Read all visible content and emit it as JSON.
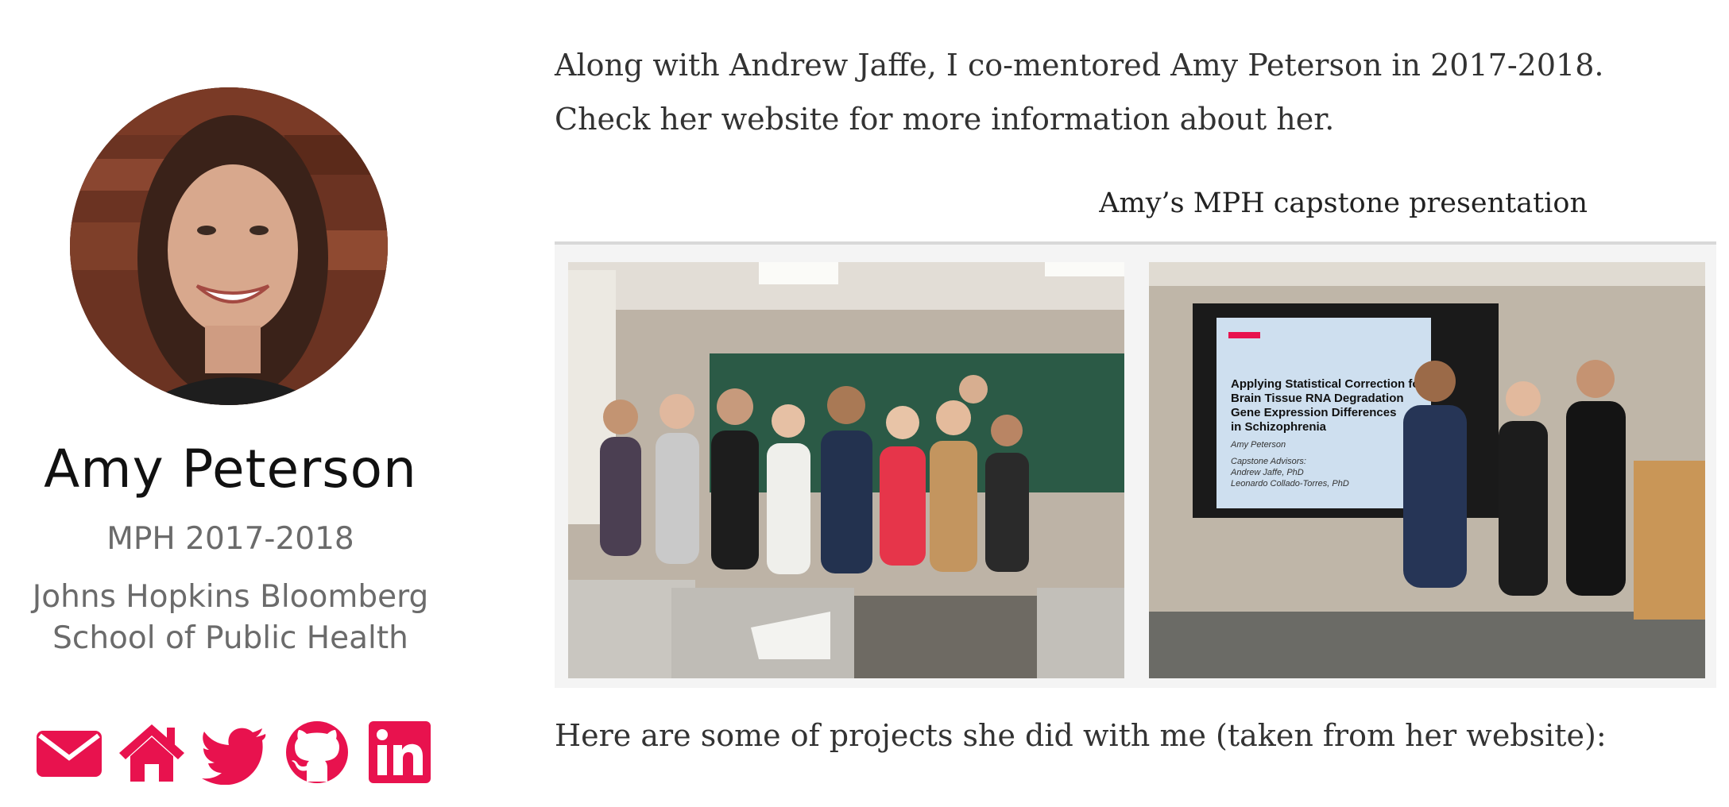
{
  "profile": {
    "name": "Amy Peterson",
    "role": "MPH 2017-2018",
    "org_line1": "Johns Hopkins Bloomberg",
    "org_line2": "School of Public Health"
  },
  "social": [
    {
      "icon": "envelope-icon"
    },
    {
      "icon": "home-icon"
    },
    {
      "icon": "twitter-icon"
    },
    {
      "icon": "github-icon"
    },
    {
      "icon": "linkedin-icon"
    }
  ],
  "colors": {
    "accent": "#e8124e",
    "text": "#333333",
    "muted": "#6b6b6b"
  },
  "content": {
    "intro": "Along with Andrew Jaffe, I co-mentored Amy Peterson in 2017-2018. Check her website for more information about her.",
    "gallery_caption": "Amy’s MPH capstone presentation",
    "outro": "Here are some of projects she did with me (taken from her website):"
  },
  "slide": {
    "title_line1": "Applying Statistical Correction for",
    "title_line2": "Brain Tissue RNA Degradation",
    "title_line3": "Gene Expression Differences",
    "title_line4": "in Schizophrenia",
    "author": "Amy Peterson",
    "advisors_label": "Capstone Advisors:",
    "advisor1": "Andrew Jaffe, PhD",
    "advisor2": "Leonardo Collado-Torres, PhD"
  }
}
